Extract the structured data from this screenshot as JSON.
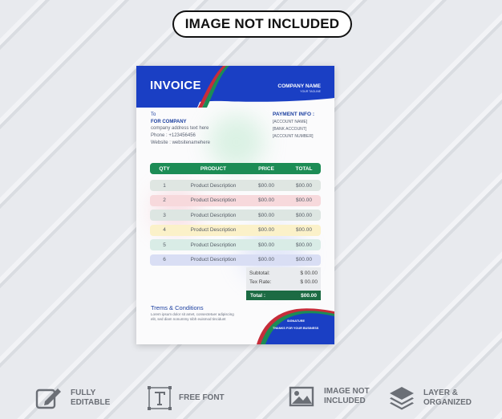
{
  "badge": "IMAGE NOT INCLUDED",
  "invoice": {
    "title": "INVOICE",
    "company_name": "COMPANY NAME",
    "tagline": "YOUR TAGLINE",
    "to_label": "To",
    "client": "FOR COMPANY",
    "address": "company address text here",
    "phone": "Phone : +123456456",
    "website": "Website : websitenamehere",
    "payment": {
      "heading": "PAYMENT INFO :",
      "lines": [
        "[ACCOUNT NAME]",
        "[BANK ACCOUNT]",
        "[ACCOUNT NUMBER]"
      ]
    },
    "columns": [
      "QTY",
      "PRODUCT",
      "PRICE",
      "TOTAL"
    ],
    "rows": [
      {
        "qty": "1",
        "product": "Product Description",
        "price": "$00.00",
        "total": "$00.00"
      },
      {
        "qty": "2",
        "product": "Product Description",
        "price": "$00.00",
        "total": "$00.00"
      },
      {
        "qty": "3",
        "product": "Product Description",
        "price": "$00.00",
        "total": "$00.00"
      },
      {
        "qty": "4",
        "product": "Product Description",
        "price": "$00.00",
        "total": "$00.00"
      },
      {
        "qty": "5",
        "product": "Product Description",
        "price": "$00.00",
        "total": "$00.00"
      },
      {
        "qty": "6",
        "product": "Product Description",
        "price": "$00.00",
        "total": "$00.00"
      }
    ],
    "row_colors": [
      "#dfe6e2",
      "#f7d9dc",
      "#dde6e2",
      "#fbf1c9",
      "#d9ece6",
      "#d9def4"
    ],
    "subtotal_label": "Subtotal:",
    "subtotal": "$ 00.00",
    "tax_label": "Tex Rate:",
    "tax": "$ 00.00",
    "total_label": "Total :",
    "total": "$00.00",
    "terms_title": "Trems & Conditions",
    "terms_text": "Lorem ipsum dolor sit amet, consectetuer adipiscing elit, sed diam nonummy nibh euismod tincidunt",
    "signature": "SIGNATURE",
    "thanks": "THANKS FOR YOUR BUSINESS"
  },
  "features": [
    {
      "line1": "FULLY",
      "line2": "EDITABLE",
      "icon": "edit-icon"
    },
    {
      "line1": "FREE FONT",
      "line2": "",
      "icon": "text-tool-icon"
    },
    {
      "line1": "IMAGE NOT",
      "line2": "INCLUDED",
      "icon": "image-icon"
    },
    {
      "line1": "LAYER &",
      "line2": "ORGANIZED",
      "icon": "layers-icon"
    }
  ],
  "colors": {
    "brand_blue": "#1a3fc4",
    "brand_green": "#1c8c55",
    "accent_red": "#c62d3a"
  }
}
